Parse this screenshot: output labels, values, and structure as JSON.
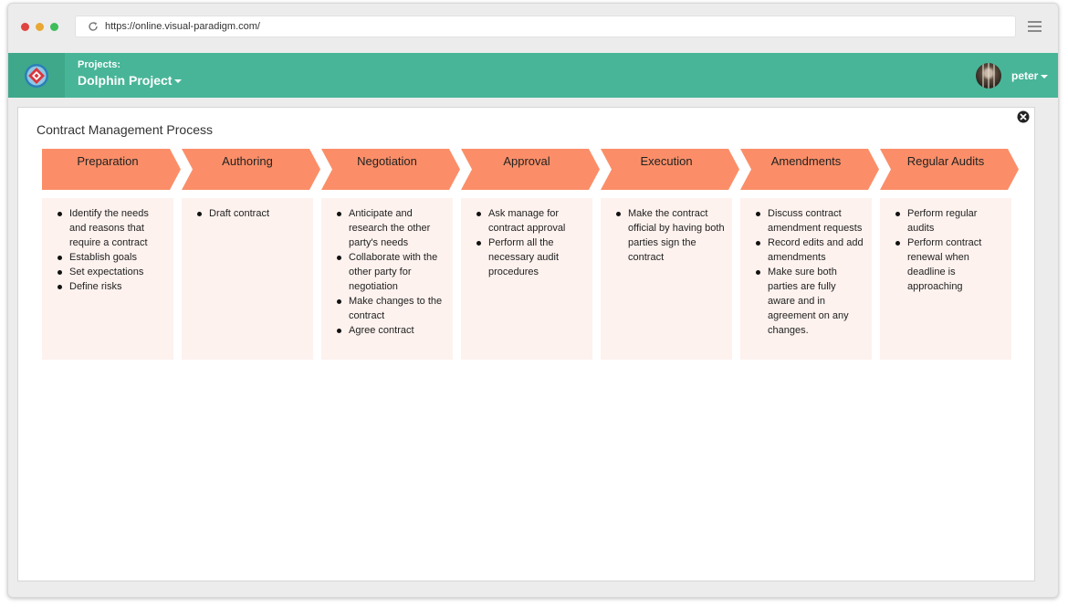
{
  "browser": {
    "url": "https://online.visual-paradigm.com/"
  },
  "app": {
    "projects_label": "Projects:",
    "project_name": "Dolphin Project",
    "user_name": "peter",
    "accent_color": "#48b598"
  },
  "diagram": {
    "title": "Contract Management Process",
    "arrow_color": "#fb8e68",
    "box_color": "#fdf2ee",
    "stages": [
      {
        "label": "Preparation",
        "items": [
          "Identify the needs and reasons that require a contract",
          "Establish goals",
          "Set expectations",
          "Define risks"
        ]
      },
      {
        "label": "Authoring",
        "items": [
          "Draft contract"
        ]
      },
      {
        "label": "Negotiation",
        "items": [
          "Anticipate and research the other party's needs",
          "Collaborate with the other party for negotiation",
          "Make changes to the contract",
          "Agree contract"
        ]
      },
      {
        "label": "Approval",
        "items": [
          "Ask manage for contract approval",
          "Perform all the necessary audit procedures"
        ]
      },
      {
        "label": "Execution",
        "items": [
          "Make the contract official by having both parties sign the contract"
        ]
      },
      {
        "label": "Amendments",
        "items": [
          "Discuss contract amendment requests",
          "Record edits and add amendments",
          "Make sure both parties are fully aware and in agreement on any changes."
        ]
      },
      {
        "label": "Regular Audits",
        "items": [
          "Perform regular audits",
          "Perform contract renewal when deadline is approaching"
        ]
      }
    ]
  }
}
